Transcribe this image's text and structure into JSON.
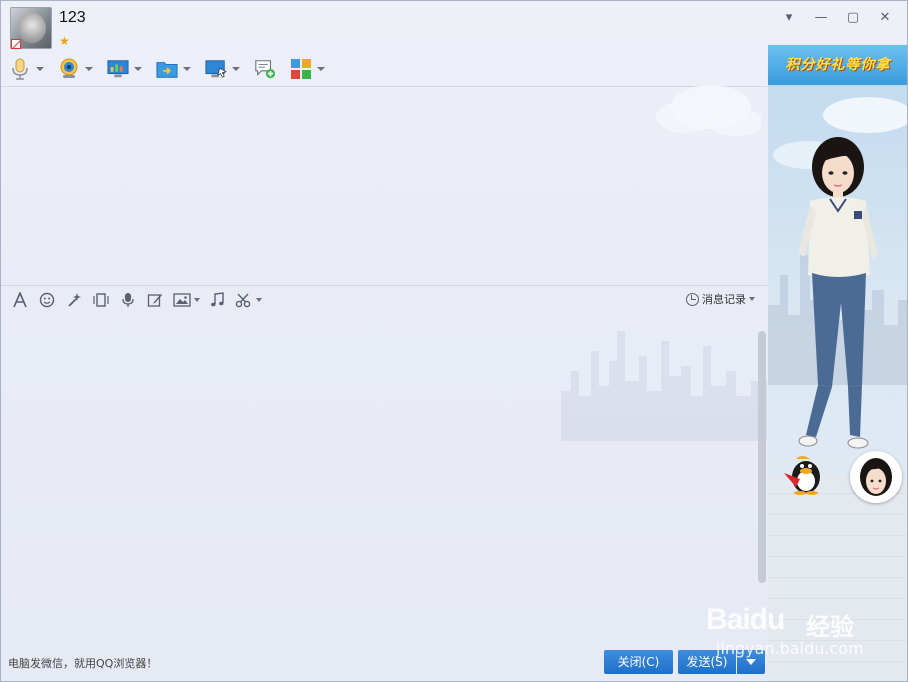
{
  "header": {
    "contact_name": "123"
  },
  "window_controls": {
    "menu": "▾",
    "minimize": "—",
    "maximize": "▢",
    "close": "✕"
  },
  "top_toolbar": [
    {
      "name": "voice-call",
      "icon": "microphone-icon"
    },
    {
      "name": "video-call",
      "icon": "webcam-icon"
    },
    {
      "name": "remote-desktop",
      "icon": "screen-share-icon"
    },
    {
      "name": "send-file",
      "icon": "folder-transfer-icon"
    },
    {
      "name": "remote-assist",
      "icon": "monitor-cursor-icon"
    },
    {
      "name": "create-discussion",
      "icon": "chat-add-icon"
    },
    {
      "name": "apps",
      "icon": "app-grid-icon"
    }
  ],
  "input_toolbar": {
    "history_label": "消息记录"
  },
  "footer": {
    "promo_link": "电脑发微信，就用QQ浏览器！",
    "close_button": "关闭(C)",
    "send_button": "发送(S)"
  },
  "side_panel": {
    "banner_text": "积分好礼等你拿"
  },
  "watermark": {
    "brand": "Baidu",
    "brand_cn": "经验",
    "url": "jingyan.baidu.com"
  },
  "colors": {
    "accent_blue": "#1e6fc8",
    "banner_text": "#ffe34a",
    "window_bg": "#eef0f8"
  }
}
